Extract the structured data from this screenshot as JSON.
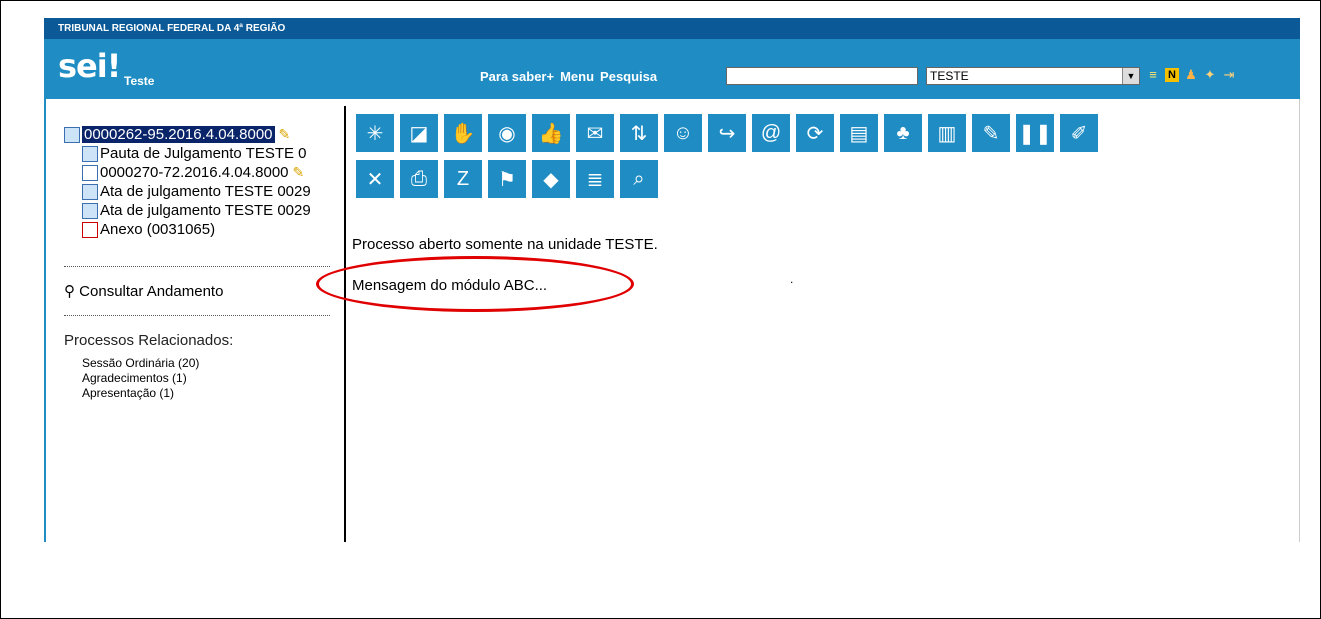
{
  "header": {
    "org_title": "TRIBUNAL REGIONAL FEDERAL DA 4ª REGIÃO",
    "logo": "sei!",
    "logo_subtitle": "Teste",
    "links": [
      "Para saber+",
      "Menu",
      "Pesquisa"
    ],
    "search": {
      "value": "",
      "placeholder": ""
    },
    "unit_select": {
      "selected": "TESTE"
    },
    "icons": [
      "list-icon",
      "note-icon",
      "user-icon",
      "tools-icon",
      "exit-icon"
    ]
  },
  "tree": {
    "items": [
      {
        "label": "0000262-95.2016.4.04.8000",
        "icon": "process-icon",
        "selected": true,
        "key": true
      },
      {
        "label": "Pauta de Julgamento TESTE 0",
        "icon": "document-icon"
      },
      {
        "label": "0000270-72.2016.4.04.8000",
        "icon": "process-icon",
        "key": true
      },
      {
        "label": "Ata de julgamento TESTE 0029",
        "icon": "document-icon"
      },
      {
        "label": "Ata de julgamento TESTE 0029",
        "icon": "document-icon"
      },
      {
        "label": "Anexo (0031065)",
        "icon": "pdf-icon"
      }
    ]
  },
  "consult_label": "Consultar Andamento",
  "related": {
    "title": "Processos Relacionados:",
    "items": [
      "Sessão Ordinária (20)",
      "Agradecimentos (1)",
      "Apresentação (1)"
    ]
  },
  "toolbar": {
    "row1": [
      {
        "name": "new-document-icon",
        "glyph": "✳"
      },
      {
        "name": "start-related-process-icon",
        "glyph": "◪"
      },
      {
        "name": "assign-process-icon",
        "glyph": "✋"
      },
      {
        "name": "view-icon",
        "glyph": "◉"
      },
      {
        "name": "credential-icon",
        "glyph": "👍"
      },
      {
        "name": "send-email-icon",
        "glyph": "✉"
      },
      {
        "name": "send-process-icon",
        "glyph": "⇅"
      },
      {
        "name": "interested-icon",
        "glyph": "☺"
      },
      {
        "name": "forward-icon",
        "glyph": "↪"
      },
      {
        "name": "email-icon",
        "glyph": "@"
      },
      {
        "name": "update-icon",
        "glyph": "⟳"
      },
      {
        "name": "bookshelf-icon",
        "glyph": "▤"
      },
      {
        "name": "relate-icon",
        "glyph": "♣"
      },
      {
        "name": "building-icon",
        "glyph": "▥"
      },
      {
        "name": "annotation-icon",
        "glyph": "✎"
      },
      {
        "name": "pause-icon",
        "glyph": "❚❚"
      },
      {
        "name": "edit-icon",
        "glyph": "✐"
      }
    ],
    "row2": [
      {
        "name": "cancel-icon",
        "glyph": "✕"
      },
      {
        "name": "pdf-icon",
        "glyph": "⎙"
      },
      {
        "name": "zip-icon",
        "glyph": "Z"
      },
      {
        "name": "flag-icon",
        "glyph": "⚑"
      },
      {
        "name": "tag-icon",
        "glyph": "◆"
      },
      {
        "name": "list-icon",
        "glyph": "≣"
      },
      {
        "name": "search-icon",
        "glyph": "⌕"
      }
    ]
  },
  "messages": {
    "open_only": "Processo aberto somente na unidade TESTE.",
    "module": "Mensagem do módulo ABC...",
    "dot": "."
  },
  "colors": {
    "header_dark": "#0b5a97",
    "header": "#1f8dc4",
    "highlight": "#e00000"
  }
}
